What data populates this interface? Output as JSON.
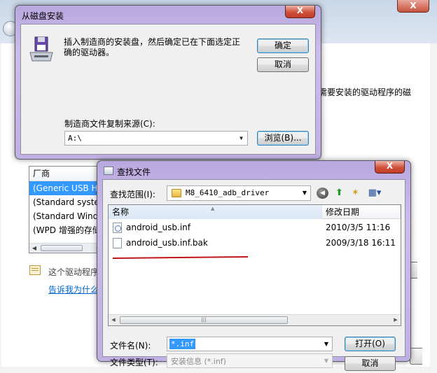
{
  "background_wizard": {
    "close_glyph": "X",
    "description_fragment": "需要安装的驱动程序的磁",
    "manufacturer_header": "厂商",
    "manufacturers": [
      "(Generic USB H",
      "(Standard syste",
      "(Standard Wind",
      "(WPD 增强的存储"
    ],
    "signature_text": "这个驱动程序",
    "signature_link": "告诉我为什么"
  },
  "install_from_disk": {
    "title": "从磁盘安装",
    "close_glyph": "X",
    "instruction": "插入制造商的安装盘，然后确定已在下面选定正确的驱动器。",
    "ok_label": "确定",
    "cancel_label": "取消",
    "source_label": "制造商文件复制来源(C):",
    "source_value": "A:\\",
    "browse_label": "浏览(B)..."
  },
  "find_file": {
    "title": "查找文件",
    "close_glyph": "X",
    "look_in_label": "查找范围(I):",
    "look_in_value": "M8_6410_adb_driver",
    "columns": {
      "name": "名称",
      "date": "修改日期"
    },
    "files": [
      {
        "name": "android_usb.inf",
        "date": "2010/3/5 11:16"
      },
      {
        "name": "android_usb.inf.bak",
        "date": "2009/3/18 16:11"
      }
    ],
    "filename_label": "文件名(N):",
    "filename_value": "*.inf",
    "filetype_label": "文件类型(T):",
    "filetype_value": "安装信息 (*.inf)",
    "open_label": "打开(O)",
    "cancel_label": "取消",
    "highlight_color": "#c0141c"
  }
}
